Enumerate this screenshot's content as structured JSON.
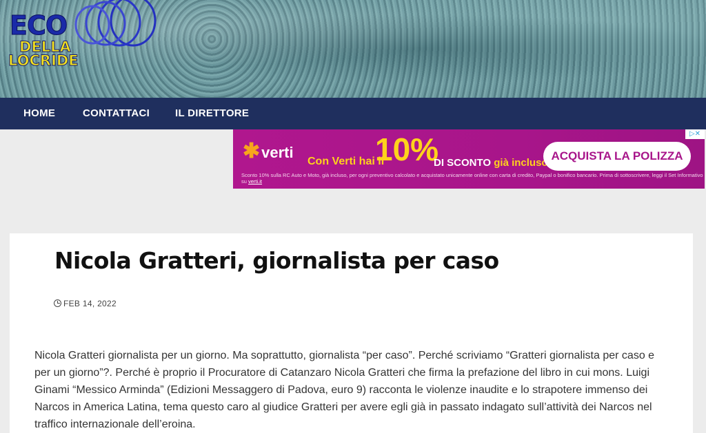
{
  "site": {
    "logo_line1": "ECO",
    "logo_line2": "DELLA",
    "logo_line3": "LOCRIDE"
  },
  "nav": {
    "items": [
      {
        "label": "HOME"
      },
      {
        "label": "CONTATTACI"
      },
      {
        "label": "IL DIRETTORE"
      }
    ]
  },
  "ad": {
    "brand": "verti",
    "claim": "Con Verti hai il",
    "percent": "10%",
    "sconto": "DI SCONTO",
    "incluso": "già incluso!",
    "cta": "ACQUISTA LA POLIZZA",
    "fine_print": "Sconto 10% sulla RC Auto e Moto, già incluso, per ogni preventivo calcolato e acquistato unicamente online con carta di credito, Paypal o bonifico bancario. Prima di sottoscrivere, leggi il Set Informativo su",
    "fine_link": "verti.it"
  },
  "article": {
    "title": "Nicola Gratteri, giornalista per caso",
    "date": "FEB 14, 2022",
    "body": "Nicola Gratteri giornalista per un giorno. Ma soprattutto, giornalista “per caso”. Perché scriviamo “Gratteri giornalista per caso e per un giorno”?. Perché è proprio il Procuratore di Catanzaro Nicola Gratteri che firma la prefazione del libro in cui mons. Luigi Ginami “Messico Arminda” (Edizioni Messaggero di Padova, euro 9) racconta le violenze inaudite e lo strapotere immenso dei Narcos in America Latina, tema questo caro al giudice Gratteri per avere egli già in passato indagato sull’attività dei Narcos nel traffico internazionale dell’eroina."
  },
  "colors": {
    "nav_bg": "#1f2f5e",
    "ad_bg": "#a8158a",
    "ad_accent": "#ffd21c"
  }
}
